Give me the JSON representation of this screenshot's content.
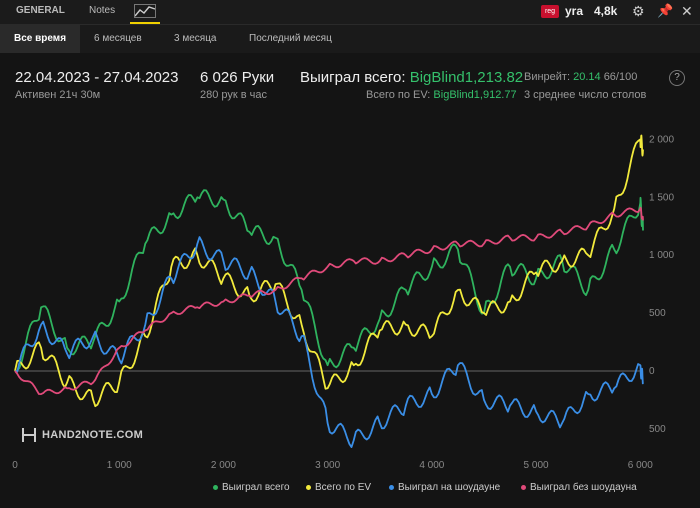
{
  "tabs": {
    "general": "GENERAL",
    "notes": "Notes"
  },
  "header": {
    "site_badge": "reg",
    "player": "yra",
    "hands_short": "4,8k"
  },
  "periods": [
    "Все время",
    "6 месяцев",
    "3 месяца",
    "Последний месяц"
  ],
  "stats": {
    "date_range": "22.04.2023 - 27.04.2023",
    "active": "Активен 21ч 30м",
    "hands": "6 026 Руки",
    "hands_per_hour": "280 рук в час",
    "won_total_label": "Выиграл всего:",
    "won_total_value": "BigBlind1,213.82",
    "ev_label": "Всего по EV:",
    "ev_value": "BigBlind1,912.77",
    "winrate_label": "Винрейт:",
    "winrate_value": "20.14",
    "winrate_ratio": "66/100",
    "avg_tables": "3 среднее число столов"
  },
  "logo": "HAND2NOTE.COM",
  "colors": {
    "green": "#2fb35e",
    "yellow": "#f2ea3c",
    "blue": "#3a8ee6",
    "pink": "#e04a7a",
    "accent": "#f0d000"
  },
  "chart_data": {
    "type": "line",
    "x": [
      0,
      250,
      500,
      750,
      1000,
      1250,
      1500,
      1750,
      2000,
      2250,
      2500,
      2750,
      3000,
      3250,
      3500,
      3750,
      4000,
      4250,
      4500,
      4750,
      5000,
      5250,
      5500,
      5750,
      6000,
      6026
    ],
    "xticks": [
      "0",
      "1 000",
      "2 000",
      "3 000",
      "4 000",
      "5 000",
      "6 000"
    ],
    "xtick_values": [
      0,
      1000,
      2000,
      3000,
      4000,
      5000,
      6000
    ],
    "yticks": [
      "2 000",
      "1 500",
      "1 000",
      "500",
      "0",
      "500"
    ],
    "ytick_values": [
      2000,
      1500,
      1000,
      500,
      0,
      -500
    ],
    "ylim": [
      -700,
      2150
    ],
    "xlim": [
      0,
      6026
    ],
    "series": [
      {
        "name": "Выиграл всего",
        "color": "#2fb35e",
        "values": [
          0,
          550,
          200,
          250,
          600,
          1100,
          1350,
          1500,
          1480,
          1200,
          1150,
          700,
          50,
          200,
          450,
          700,
          900,
          1050,
          500,
          900,
          800,
          950,
          700,
          1050,
          1450,
          1213
        ]
      },
      {
        "name": "Всего по EV",
        "color": "#f2ea3c",
        "values": [
          0,
          200,
          -100,
          -250,
          -100,
          300,
          900,
          1000,
          800,
          650,
          750,
          400,
          -150,
          50,
          350,
          400,
          300,
          700,
          500,
          600,
          850,
          950,
          1000,
          1400,
          2000,
          1913
        ]
      },
      {
        "name": "Выиграл на шоудауне",
        "color": "#3a8ee6",
        "values": [
          0,
          400,
          150,
          300,
          100,
          400,
          800,
          1100,
          950,
          850,
          600,
          300,
          -450,
          -600,
          -450,
          -300,
          -200,
          50,
          -250,
          -300,
          -350,
          -450,
          -200,
          -150,
          50,
          -100
        ]
      },
      {
        "name": "Выиграл без шоудауна",
        "color": "#e04a7a",
        "values": [
          0,
          -200,
          -150,
          -100,
          200,
          350,
          500,
          550,
          600,
          650,
          700,
          800,
          900,
          950,
          950,
          1000,
          1050,
          1100,
          1100,
          1150,
          1150,
          1200,
          1250,
          1350,
          1400,
          1300
        ]
      }
    ]
  }
}
